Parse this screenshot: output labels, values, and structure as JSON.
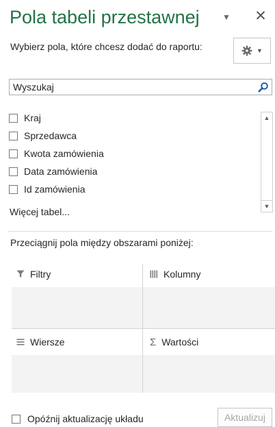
{
  "pane": {
    "title": "Pola tabeli przestawnej",
    "subtitle": "Wybierz pola, które chcesz dodać do raportu:"
  },
  "search": {
    "placeholder": "Wyszukaj"
  },
  "fields": [
    {
      "label": "Kraj",
      "checked": false
    },
    {
      "label": "Sprzedawca",
      "checked": false
    },
    {
      "label": "Kwota zamówienia",
      "checked": false
    },
    {
      "label": "Data zamówienia",
      "checked": false
    },
    {
      "label": "Id zamówienia",
      "checked": false
    }
  ],
  "more_tables": "Więcej tabel...",
  "drag_instruction": "Przeciągnij pola między obszarami poniżej:",
  "areas": {
    "filters": "Filtry",
    "columns": "Kolumny",
    "rows": "Wiersze",
    "values": "Wartości"
  },
  "footer": {
    "defer_label": "Opóźnij aktualizację układu",
    "defer_checked": false,
    "update_label": "Aktualizuj"
  },
  "icons": {
    "title_dropdown": "chevron-down-icon",
    "close": "close-icon",
    "tools": "gear-icon",
    "search": "search-icon",
    "filters": "filter-icon",
    "columns": "columns-icon",
    "rows": "rows-icon",
    "values": "sigma-icon"
  },
  "colors": {
    "title": "#217346",
    "drop_area": "#f3f3f3",
    "search_icon": "#1f5fa8"
  }
}
